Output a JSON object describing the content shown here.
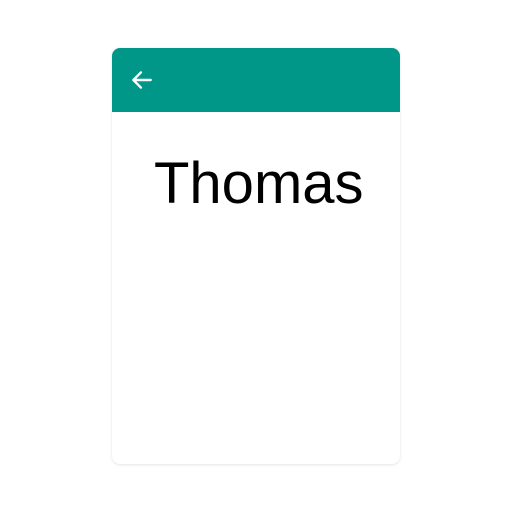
{
  "card": {
    "header_color": "#009688",
    "back_icon": "arrow-left-icon",
    "name": "Thomas"
  }
}
